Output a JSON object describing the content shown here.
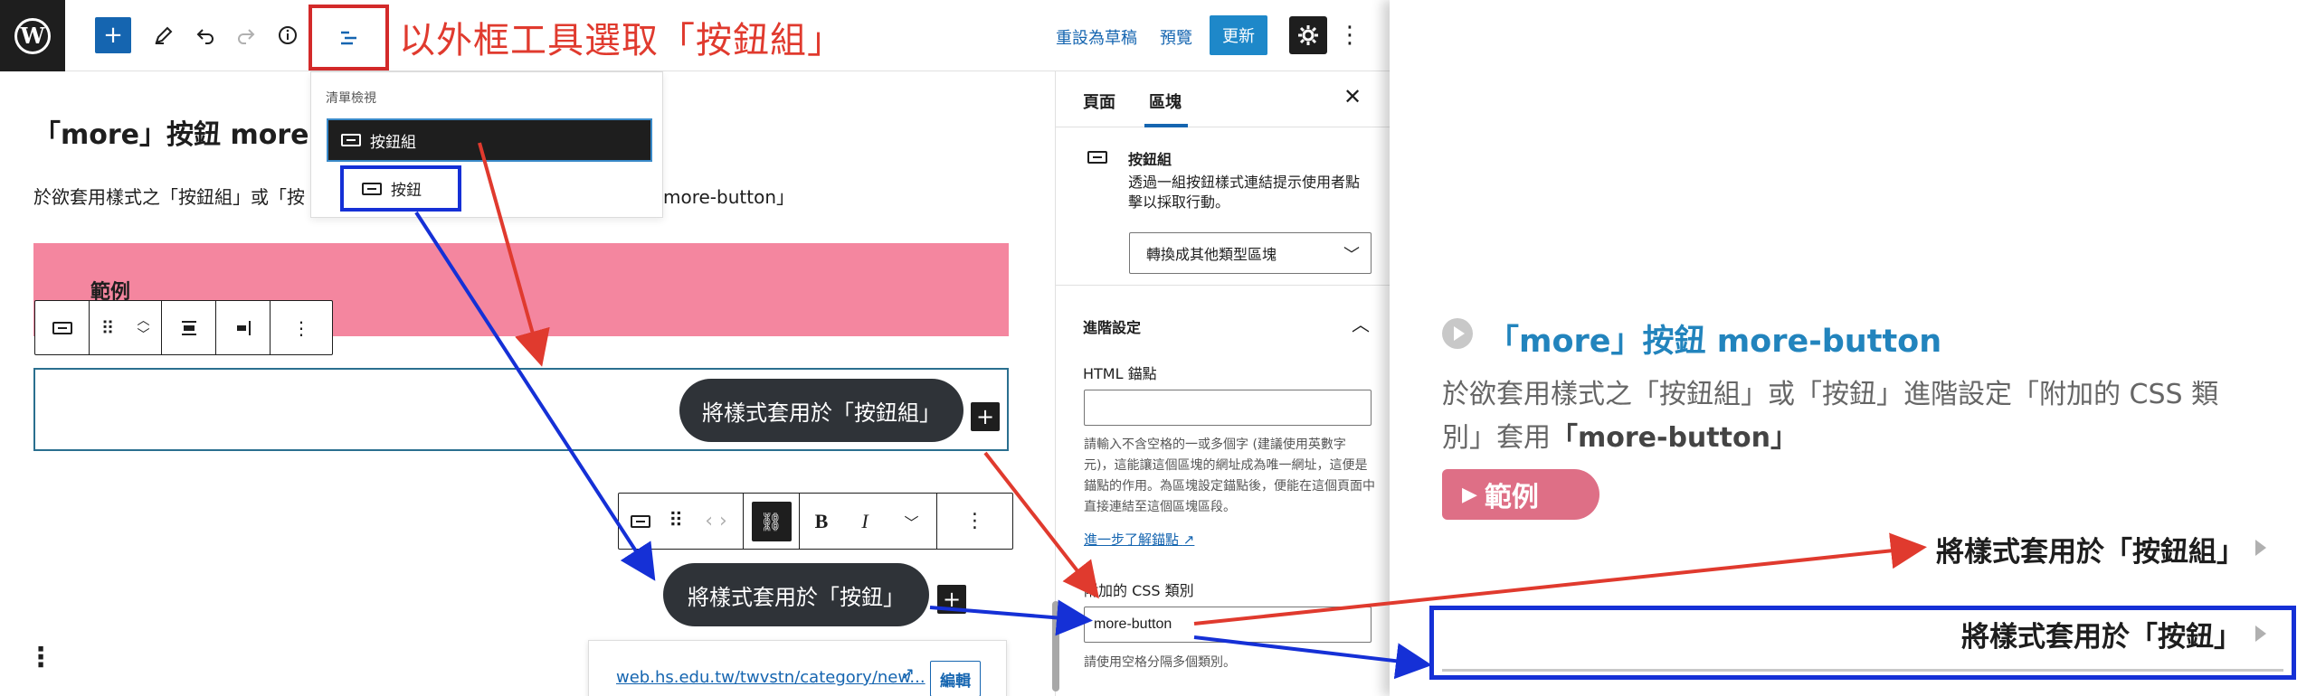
{
  "topbar": {
    "logo": "W",
    "annotation_title": "以外框工具選取「按鈕組」",
    "revert_label": "重設為草稿",
    "preview_label": "預覽",
    "update_label": "更新",
    "icons": [
      "wordpress-logo",
      "plus-icon",
      "pencil-icon",
      "undo-icon",
      "redo-icon",
      "info-icon",
      "list-view-icon",
      "gear-icon",
      "more-vertical-icon"
    ]
  },
  "list_view": {
    "heading": "清單檢視",
    "items": [
      {
        "label": "按鈕組"
      },
      {
        "label": "按鈕"
      }
    ]
  },
  "content": {
    "title": "「more」按鈕 more-b",
    "para_head": "於欲套用樣式之「按鈕組」或「按",
    "para_tail": "more-button」",
    "example_title": "範例",
    "button_group_pill": "將樣式套用於「按鈕組」",
    "button_pill": "將樣式套用於「按鈕」",
    "link_url": "web.hs.edu.tw/twvstn/category/new...",
    "edit_label": "編輯"
  },
  "sidebar": {
    "tab_page": "頁面",
    "tab_block": "區塊",
    "block_name": "按鈕組",
    "block_desc": "透過一組按鈕樣式連結提示使用者點擊以採取行動。",
    "transform_label": "轉換成其他類型區塊",
    "advanced_title": "進階設定",
    "anchor_label": "HTML 錨點",
    "anchor_value": "",
    "anchor_help": "請輸入不含空格的一或多個字 (建議使用英數字元)，這能讓這個區塊的網址成為唯一網址，這便是錨點的作用。為區塊設定錨點後，便能在這個頁面中直接連結至這個區塊區段。",
    "learn_more": "進一步了解錨點",
    "css_label": "附加的 CSS 類別",
    "css_value": "more-button",
    "css_help": "請使用空格分隔多個類別。"
  },
  "preview": {
    "title": "「more」按鈕 more-button",
    "para_line1": "於欲套用樣式之「按鈕組」或「按鈕」進階設定「附加的 CSS 類",
    "para_line2_start": "別」套用",
    "para_line2_bold": "「more-button」",
    "example_label": "範例",
    "button_group_label": "將樣式套用於「按鈕組」",
    "button_label": "將樣式套用於「按鈕」"
  },
  "colors": {
    "annotation_red": "#e03a2e",
    "annotation_blue": "#1530d6",
    "wp_blue": "#1565b0",
    "example_pink": "#f4869f",
    "preview_title_blue": "#2284bd"
  }
}
